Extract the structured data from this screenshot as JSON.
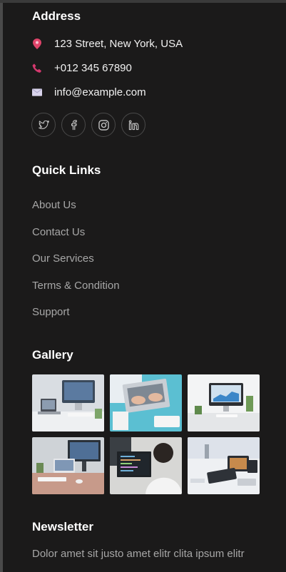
{
  "address": {
    "heading": "Address",
    "street": "123 Street, New York, USA",
    "phone": "+012 345 67890",
    "email": "info@example.com"
  },
  "social_icons": [
    "twitter-icon",
    "facebook-icon",
    "instagram-icon",
    "linkedin-icon"
  ],
  "quick_links": {
    "heading": "Quick Links",
    "items": [
      "About Us",
      "Contact Us",
      "Our Services",
      "Terms & Condition",
      "Support"
    ]
  },
  "gallery": {
    "heading": "Gallery",
    "count": 6
  },
  "newsletter": {
    "heading": "Newsletter",
    "text": "Dolor amet sit justo amet elitr clita ipsum elitr"
  },
  "colors": {
    "background": "#1b1a1a",
    "heading": "#ffffff",
    "link": "#a7a7a7",
    "accent_pin": "#e0446a"
  }
}
